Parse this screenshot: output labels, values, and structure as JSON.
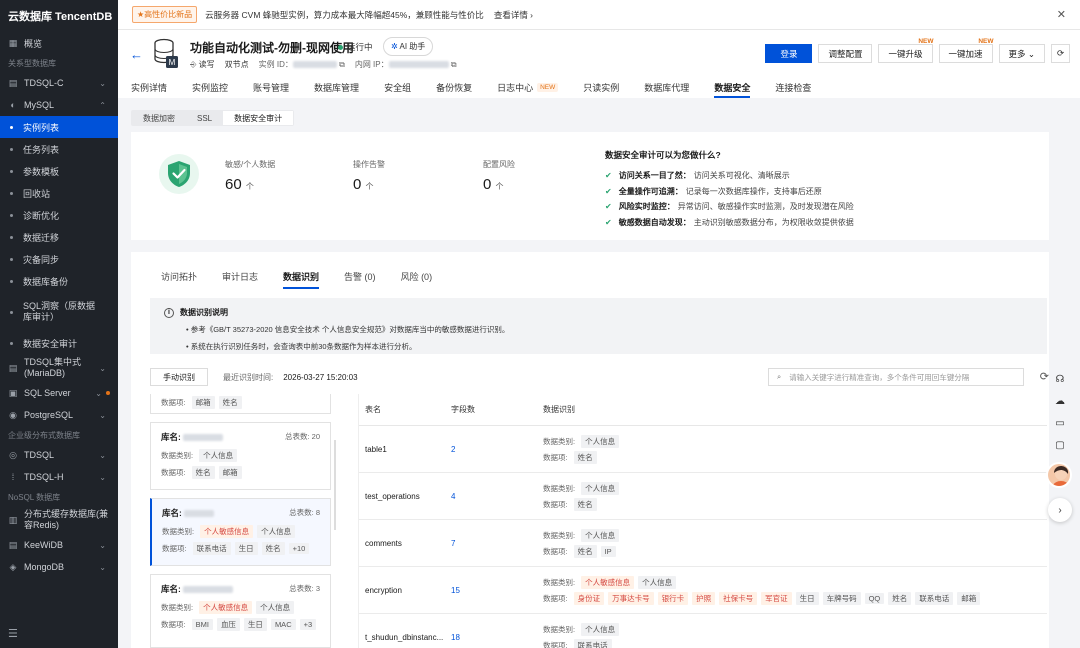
{
  "sidebar": {
    "logo": "云数据库 TencentDB",
    "overview": "概览",
    "cat_relational": "关系型数据库",
    "tdsql_c": "TDSQL-C",
    "mysql": "MySQL",
    "mysql_items": [
      "实例列表",
      "任务列表",
      "参数模板",
      "回收站",
      "诊断优化",
      "数据迁移",
      "灾备同步",
      "数据库备份",
      "SQL洞察（原数据库审计）",
      "数据安全审计"
    ],
    "tdsql_cluster": "TDSQL集中式(MariaDB)",
    "sqlserver": "SQL Server",
    "postgresql": "PostgreSQL",
    "cat_enterprise": "企业级分布式数据库",
    "tdsql": "TDSQL",
    "tdsql_h": "TDSQL-H",
    "cat_nosql": "NoSQL 数据库",
    "redis": "分布式缓存数据库(兼容Redis)",
    "keewidb": "KeeWiDB",
    "mongodb": "MongoDB"
  },
  "banner": {
    "tag": "★高性价比新品",
    "text": "云服务器 CVM 蜂驰型实例，算力成本最大降幅超45%，兼顾性能与性价比",
    "link": "查看详情 ›"
  },
  "header": {
    "title": "功能自动化测试-勿删-现网使用",
    "status": "运行中",
    "ai": "AI 助手",
    "rw": "读写",
    "nodes": "双节点",
    "instance_id_label": "实例 ID：",
    "ip_label": "内网 IP：",
    "buttons": {
      "login": "登录",
      "adjust": "调整配置",
      "upgrade": "一键升级",
      "accelerate": "一键加速",
      "more": "更多 ⌄",
      "new": "NEW"
    }
  },
  "tabs": [
    "实例详情",
    "实例监控",
    "账号管理",
    "数据库管理",
    "安全组",
    "备份恢复",
    "日志中心",
    "只读实例",
    "数据库代理",
    "数据安全",
    "连接检查"
  ],
  "tab_new": "NEW",
  "subtabs": [
    "数据加密",
    "SSL",
    "数据安全审计"
  ],
  "stats": [
    {
      "label": "敏感/个人数据",
      "value": "60",
      "unit": "个"
    },
    {
      "label": "操作告警",
      "value": "0",
      "unit": "个"
    },
    {
      "label": "配置风险",
      "value": "0",
      "unit": "个"
    }
  ],
  "why": {
    "title": "数据安全审计可以为您做什么?",
    "rows": [
      {
        "bold": "访问关系一目了然：",
        "text": "访问关系可视化、清晰展示"
      },
      {
        "bold": "全量操作可追溯：",
        "text": "记录每一次数据库操作，支持事后还原"
      },
      {
        "bold": "风险实时监控：",
        "text": "异常访问、敏感操作实时监测，及时发现潜在风险"
      },
      {
        "bold": "敏感数据自动发现：",
        "text": "主动识别敏感数据分布，为权限收敛提供依据"
      }
    ]
  },
  "inner_tabs": [
    "访问拓扑",
    "审计日志",
    "数据识别",
    "告警 (0)",
    "风险 (0)"
  ],
  "info": {
    "title": "数据识别说明",
    "items": [
      "参考《GB/T 35273-2020 信息安全技术 个人信息安全规范》对数据库当中的敏感数据进行识别。",
      "系统在执行识别任务时，会查询表中前30条数据作为样本进行分析。"
    ]
  },
  "toolbar": {
    "manual": "手动识别",
    "last_label": "最近识别时间:",
    "last_value": "2026-03-27 15:20:03",
    "search_placeholder": "请输入关键字进行精准查询，多个条件可用回车键分隔"
  },
  "labels": {
    "db": "库名:",
    "total": "总表数:",
    "category": "数据类别:",
    "item": "数据项:"
  },
  "dbcards": [
    {
      "items": [
        "邮箱",
        "姓名"
      ]
    },
    {
      "total": "20",
      "categories": [
        {
          "t": "个人信息",
          "s": false
        }
      ],
      "items": [
        "姓名",
        "邮箱"
      ]
    },
    {
      "total": "8",
      "categories": [
        {
          "t": "个人敏感信息",
          "s": true
        },
        {
          "t": "个人信息",
          "s": false
        }
      ],
      "items": [
        "联系电话",
        "生日",
        "姓名",
        "+10"
      ]
    },
    {
      "total": "3",
      "categories": [
        {
          "t": "个人敏感信息",
          "s": true
        },
        {
          "t": "个人信息",
          "s": false
        }
      ],
      "items": [
        "BMI",
        "血压",
        "生日",
        "MAC",
        "+3"
      ]
    }
  ],
  "table": {
    "headers": [
      "表名",
      "字段数",
      "数据识别"
    ],
    "rows": [
      {
        "name": "table1",
        "count": "2",
        "categories": [
          {
            "t": "个人信息",
            "s": false
          }
        ],
        "items": [
          {
            "t": "姓名",
            "s": false
          }
        ]
      },
      {
        "name": "test_operations",
        "count": "4",
        "categories": [
          {
            "t": "个人信息",
            "s": false
          }
        ],
        "items": [
          {
            "t": "姓名",
            "s": false
          }
        ]
      },
      {
        "name": "comments",
        "count": "7",
        "categories": [
          {
            "t": "个人信息",
            "s": false
          }
        ],
        "items": [
          {
            "t": "姓名",
            "s": false
          },
          {
            "t": "IP",
            "s": false
          }
        ]
      },
      {
        "name": "encryption",
        "count": "15",
        "categories": [
          {
            "t": "个人敏感信息",
            "s": true
          },
          {
            "t": "个人信息",
            "s": false
          }
        ],
        "items": [
          {
            "t": "身份证",
            "s": true
          },
          {
            "t": "万事达卡号",
            "s": true
          },
          {
            "t": "银行卡",
            "s": true
          },
          {
            "t": "护照",
            "s": true
          },
          {
            "t": "社保卡号",
            "s": true
          },
          {
            "t": "军官证",
            "s": true
          },
          {
            "t": "生日",
            "s": false
          },
          {
            "t": "车牌号码",
            "s": false
          },
          {
            "t": "QQ",
            "s": false
          },
          {
            "t": "姓名",
            "s": false
          },
          {
            "t": "联系电话",
            "s": false
          },
          {
            "t": "邮箱",
            "s": false
          }
        ]
      },
      {
        "name": "t_shudun_dbinstanc...",
        "count": "18",
        "categories": [
          {
            "t": "个人信息",
            "s": false
          }
        ],
        "items": [
          {
            "t": "联系电话",
            "s": false
          }
        ]
      }
    ]
  }
}
